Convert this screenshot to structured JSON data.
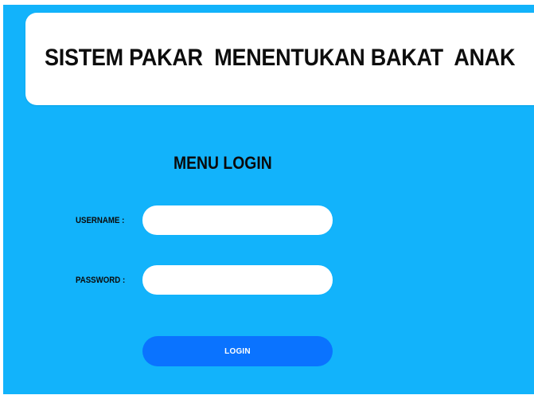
{
  "header": {
    "title": "SISTEM PAKAR  MENENTUKAN BAKAT  ANAK"
  },
  "login": {
    "title": "MENU LOGIN",
    "username_label": "USERNAME :",
    "username_value": "",
    "username_placeholder": "",
    "password_label": "PASSWORD :",
    "password_value": "",
    "password_placeholder": "",
    "button_label": "LOGIN"
  },
  "colors": {
    "background": "#12b3fb",
    "button": "#0a73ff",
    "card": "#ffffff"
  }
}
